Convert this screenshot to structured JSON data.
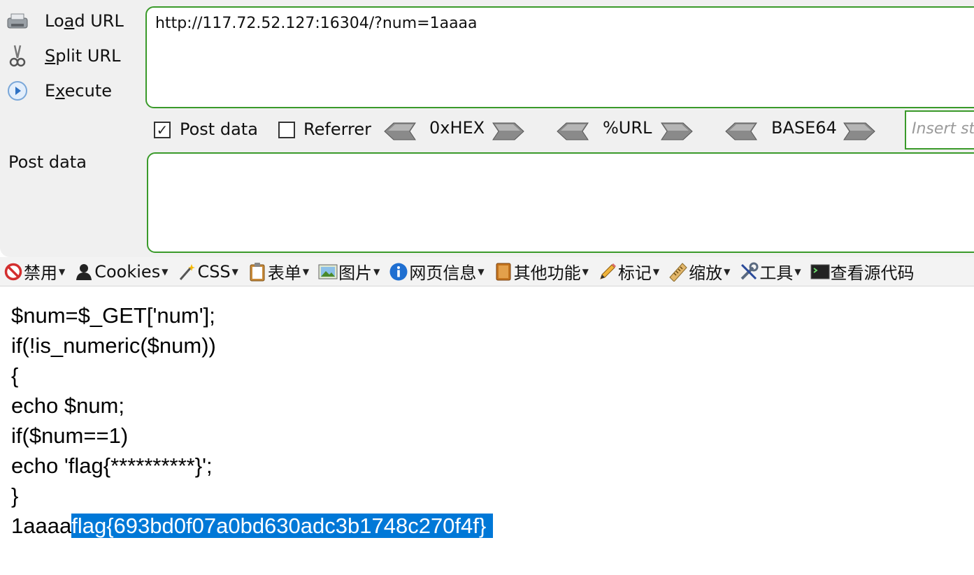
{
  "hackbar": {
    "commands": [
      {
        "label": "Load URL",
        "icon": "load-url-icon"
      },
      {
        "label": "Split URL",
        "icon": "scissors-icon"
      },
      {
        "label": "Execute",
        "icon": "play-icon"
      }
    ],
    "url_value": "http://117.72.52.127:16304/?num=1aaaa",
    "options": {
      "post_data": {
        "label": "Post data",
        "checked": true
      },
      "referrer": {
        "label": "Referrer",
        "checked": false
      }
    },
    "encoders": [
      "0xHEX",
      "%URL",
      "BASE64"
    ],
    "insert_placeholder": "Insert st",
    "post_data_label": "Post data",
    "post_data_value": "",
    "accent_color": "#3a9a2a"
  },
  "web_developer_toolbar": {
    "items": [
      {
        "label": "禁用",
        "icon": "disable-icon"
      },
      {
        "label": "Cookies",
        "icon": "cookies-icon"
      },
      {
        "label": "CSS",
        "icon": "css-wand-icon"
      },
      {
        "label": "表单",
        "icon": "form-clipboard-icon"
      },
      {
        "label": "图片",
        "icon": "image-icon"
      },
      {
        "label": "网页信息",
        "icon": "info-icon"
      },
      {
        "label": "其他功能",
        "icon": "book-icon"
      },
      {
        "label": "标记",
        "icon": "pencil-icon"
      },
      {
        "label": "缩放",
        "icon": "ruler-icon"
      },
      {
        "label": "工具",
        "icon": "tools-icon"
      },
      {
        "label": "查看源代码",
        "icon": "terminal-icon"
      }
    ]
  },
  "page": {
    "code_lines": [
      "$num=$_GET['num'];",
      "if(!is_numeric($num))",
      "{",
      "echo $num;",
      "if($num==1)",
      "echo 'flag{**********}';",
      "}"
    ],
    "output_prefix": "1aaaa",
    "output_selected": "flag{693bd0f07a0bd630adc3b1748c270f4f}",
    "selection_color": "#0078d7"
  }
}
